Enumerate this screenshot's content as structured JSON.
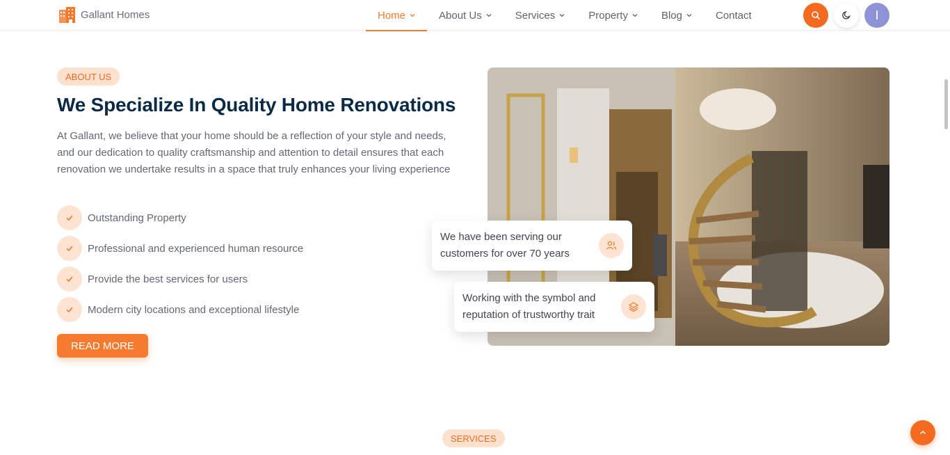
{
  "brand": {
    "name": "Gallant Homes",
    "logo_icon": "building-icon"
  },
  "nav": {
    "items": [
      {
        "label": "Home",
        "active": true,
        "dropdown": true
      },
      {
        "label": "About Us",
        "dropdown": true
      },
      {
        "label": "Services",
        "dropdown": true
      },
      {
        "label": "Property",
        "dropdown": true
      },
      {
        "label": "Blog",
        "dropdown": true
      },
      {
        "label": "Contact",
        "dropdown": false
      }
    ],
    "search_icon": "search-icon",
    "theme_icon": "moon-icon",
    "avatar_initial": "I"
  },
  "about": {
    "badge": "ABOUT US",
    "title": "We Specialize In Quality Home Renovations",
    "description": "At Gallant, we believe that your home should be a reflection of your style and needs, and our dedication to quality craftsmanship and attention to detail ensures that each renovation we undertake results in a space that truly enhances your living experience",
    "features": [
      "Outstanding Property",
      "Professional and experienced human resource",
      "Provide the best services for users",
      "Modern city locations and exceptional lifestyle"
    ],
    "button": "READ MORE",
    "cards": [
      {
        "text": "We have been serving our customers for over 70 years",
        "icon": "users-icon"
      },
      {
        "text": "Working with the symbol and reputation of trustworthy trait",
        "icon": "layers-icon"
      }
    ]
  },
  "services": {
    "badge": "SERVICES"
  },
  "colors": {
    "accent": "#f46a1f",
    "accent_light": "#fde1cf",
    "heading": "#0b2a45",
    "avatar": "#8e93d6"
  }
}
